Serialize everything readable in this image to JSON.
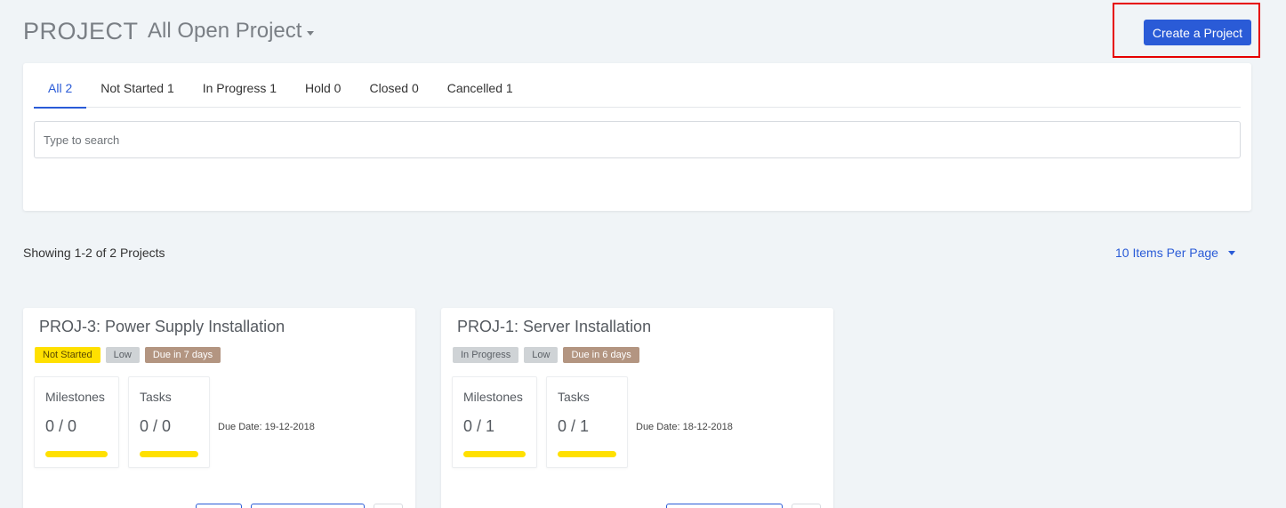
{
  "header": {
    "title": "PROJECT",
    "view_label": "All Open Project",
    "create_button": "Create a Project"
  },
  "tabs": [
    {
      "label": "All 2",
      "active": true
    },
    {
      "label": "Not Started 1",
      "active": false
    },
    {
      "label": "In Progress 1",
      "active": false
    },
    {
      "label": "Hold 0",
      "active": false
    },
    {
      "label": "Closed 0",
      "active": false
    },
    {
      "label": "Cancelled 1",
      "active": false
    }
  ],
  "search": {
    "placeholder": "Type to search",
    "value": ""
  },
  "listing": {
    "showing": "Showing 1-2 of 2 Projects",
    "per_page": "10 Items Per Page"
  },
  "projects": [
    {
      "title": "PROJ-3:  Power Supply Installation",
      "status": "Not Started",
      "priority": "Low",
      "due_badge": "Due in 7 days",
      "milestones_label": "Milestones",
      "milestones_value": "0 / 0",
      "tasks_label": "Tasks",
      "tasks_value": "0 / 0",
      "due_date": "Due Date: 19-12-2018"
    },
    {
      "title": "PROJ-1:  Server Installation",
      "status": "In Progress",
      "priority": "Low",
      "due_badge": "Due in 6 days",
      "milestones_label": "Milestones",
      "milestones_value": "0 / 1",
      "tasks_label": "Tasks",
      "tasks_value": "0 / 1",
      "due_date": "Due Date: 18-12-2018"
    }
  ],
  "colors": {
    "accent": "#2a5bd7",
    "highlight": "#e60000",
    "status_not_started": "#ffe000",
    "status_in_progress": "#cfd3d6",
    "due_badge": "#b39581"
  }
}
